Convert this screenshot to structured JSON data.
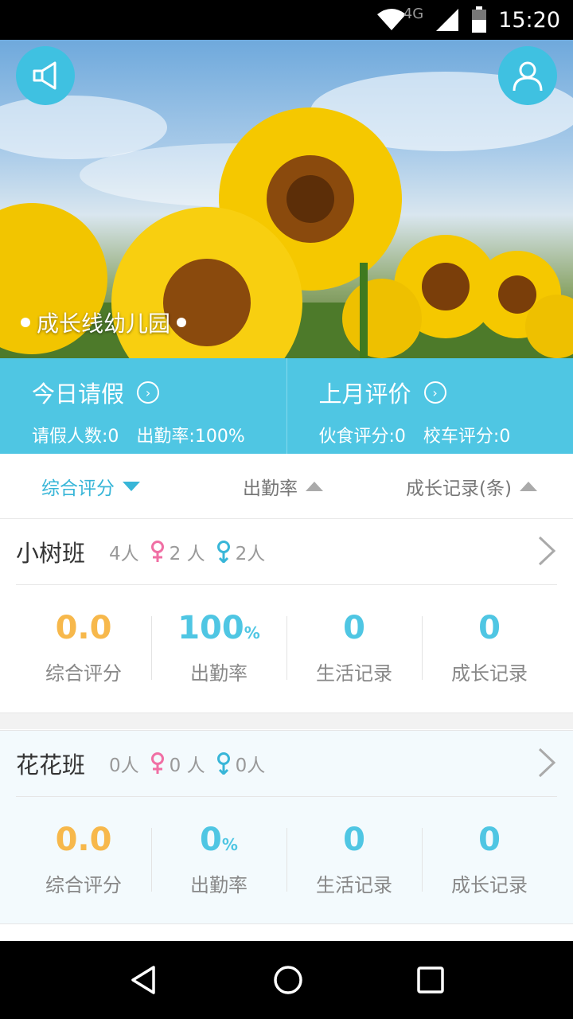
{
  "status_bar": {
    "time": "15:20",
    "network": "4G"
  },
  "hero": {
    "school_name": "成长线幼儿园"
  },
  "summary": {
    "leave": {
      "title": "今日请假",
      "leave_count": "请假人数:0",
      "attendance": "出勤率:100%"
    },
    "evaluation": {
      "title": "上月评价",
      "food_score": "伙食评分:0",
      "bus_score": "校车评分:0"
    }
  },
  "sort": {
    "overall": "综合评分",
    "attendance": "出勤率",
    "growth_records": "成长记录(条)"
  },
  "classes": [
    {
      "name": "小树班",
      "total": "4人",
      "female": "2 人",
      "male": "2人",
      "overall_score": "0.0",
      "attendance_value": "100",
      "attendance_unit": "%",
      "life_records": "0",
      "growth_records": "0"
    },
    {
      "name": "花花班",
      "total": "0人",
      "female": "0 人",
      "male": "0人",
      "overall_score": "0.0",
      "attendance_value": "0",
      "attendance_unit": "%",
      "life_records": "0",
      "growth_records": "0"
    }
  ],
  "stat_labels": {
    "overall": "综合评分",
    "attendance": "出勤率",
    "life": "生活记录",
    "growth": "成长记录"
  },
  "colors": {
    "accent": "#4fc6e3",
    "orange": "#f7b84b",
    "female": "#f06fa4",
    "male": "#38b6d8"
  }
}
